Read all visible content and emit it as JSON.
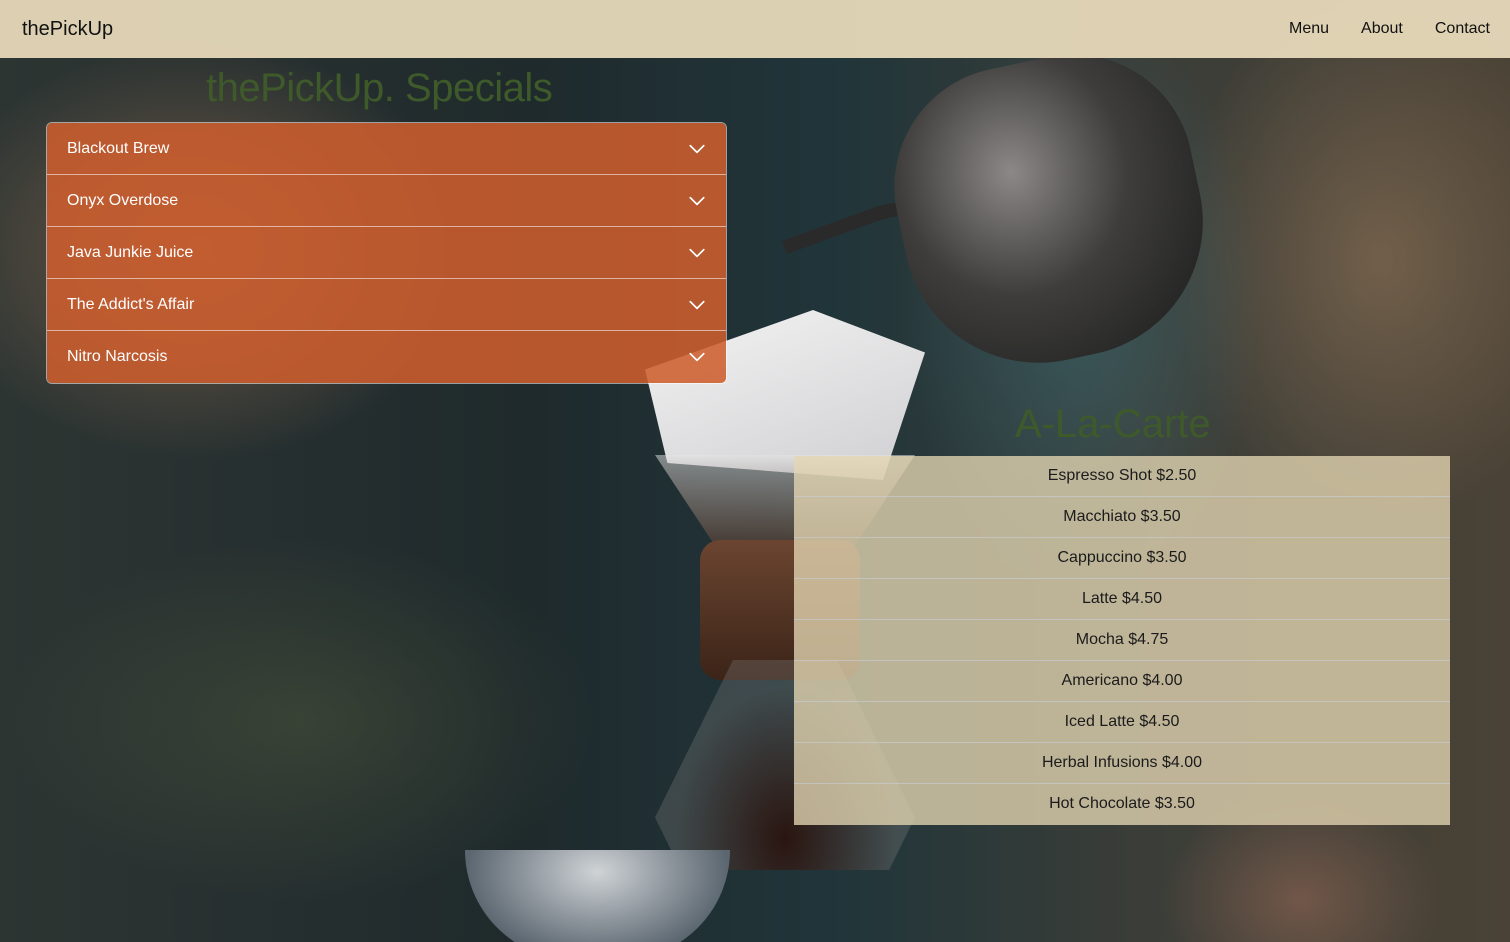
{
  "navbar": {
    "brand": "thePickUp",
    "links": [
      {
        "label": "Menu"
      },
      {
        "label": "About"
      },
      {
        "label": "Contact"
      }
    ]
  },
  "specials": {
    "title": "thePickUp. Specials",
    "items": [
      {
        "label": "Blackout Brew",
        "icon": "chevron-down-icon"
      },
      {
        "label": "Onyx Overdose",
        "icon": "chevron-down-icon"
      },
      {
        "label": "Java Junkie Juice",
        "icon": "chevron-down-icon"
      },
      {
        "label": "The Addict's Affair",
        "icon": "chevron-down-icon"
      },
      {
        "label": "Nitro Narcosis",
        "icon": "chevron-down-icon"
      }
    ]
  },
  "a_la_carte": {
    "title": "A-La-Carte",
    "items": [
      {
        "label": "Espresso Shot $2.50"
      },
      {
        "label": "Macchiato $3.50"
      },
      {
        "label": "Cappuccino $3.50"
      },
      {
        "label": "Latte $4.50"
      },
      {
        "label": "Mocha $4.75"
      },
      {
        "label": "Americano $4.00"
      },
      {
        "label": "Iced Latte $4.50"
      },
      {
        "label": "Herbal Infusions $4.00"
      },
      {
        "label": "Hot Chocolate $3.50"
      }
    ]
  },
  "colors": {
    "navbar_bg": "#ebddbc",
    "accent_orange": "#cd5d2d",
    "heading_green": "#3f5a2a",
    "list_bg": "#e4d6b2"
  }
}
